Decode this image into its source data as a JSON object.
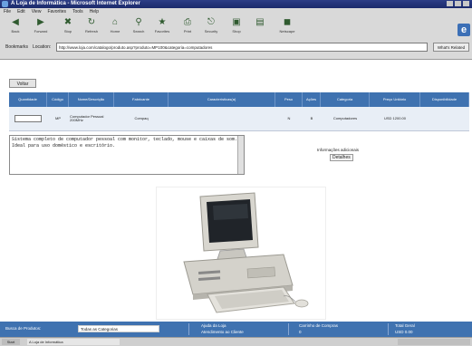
{
  "window": {
    "title": "A Loja de Informática - Microsoft Internet Explorer"
  },
  "menu": [
    "File",
    "Edit",
    "View",
    "Favorites",
    "Tools",
    "Help"
  ],
  "toolbar": {
    "buttons": [
      {
        "label": "Back",
        "icon": "back-arrow-icon"
      },
      {
        "label": "Forward",
        "icon": "forward-arrow-icon"
      },
      {
        "label": "Stop",
        "icon": "stop-icon"
      },
      {
        "label": "Refresh",
        "icon": "refresh-icon"
      },
      {
        "label": "Home",
        "icon": "home-icon"
      },
      {
        "label": "Search",
        "icon": "search-icon"
      },
      {
        "label": "Favorites",
        "icon": "favorites-icon"
      },
      {
        "label": "Print",
        "icon": "print-icon"
      },
      {
        "label": "Security",
        "icon": "security-icon"
      },
      {
        "label": "Shop",
        "icon": "shop-icon"
      },
      {
        "label": "Netscape",
        "icon": "netscape-icon"
      }
    ]
  },
  "address": {
    "bookmarks_label": "Bookmarks",
    "location_label": "Location:",
    "url": "http://www.loja.com/catalogo/produto.asp?produto=MP100&categoria=computadores",
    "go_label": "What's Related"
  },
  "page": {
    "back_button": "Voltar",
    "table": {
      "headers": [
        "Quantidade",
        "Código",
        "Nome/Descrição",
        "Fabricante",
        "Características(a)",
        "Peso",
        "Ações",
        "Categoria",
        "Preço Unitário",
        "Disponibilidade"
      ],
      "row": {
        "quantity": "",
        "code": "MP",
        "name": "Computador Pessoal 200MHz",
        "manufacturer": "Compaq",
        "specs": "",
        "weight": "N",
        "action": "B",
        "category": "Computadores",
        "price": "USD 1200.00",
        "availability": ""
      }
    },
    "description": "Sistema completo de computador pessoal com monitor, teclado, mouse e caixas de som. Ideal para uso doméstico e escritório.",
    "side_caption": "Informações adicionais",
    "side_value": "Detalhes"
  },
  "status": {
    "search_label": "Busca de Produtos:",
    "search_value": "Todas as Categorias",
    "col2_line1": "Ajuda da Loja",
    "col2_line2": "Atendimento ao Cliente",
    "col3_line1": "Carrinho de Compras",
    "col3_line2": "0",
    "col4_line1": "Total Geral",
    "col4_line2": "USD 0.00"
  },
  "taskbar": {
    "start_label": "Start",
    "task_label": "A Loja de Informática"
  },
  "colors": {
    "accent": "#3f72b0",
    "title": "#1b2a6b",
    "chrome": "#d9d9d9"
  }
}
